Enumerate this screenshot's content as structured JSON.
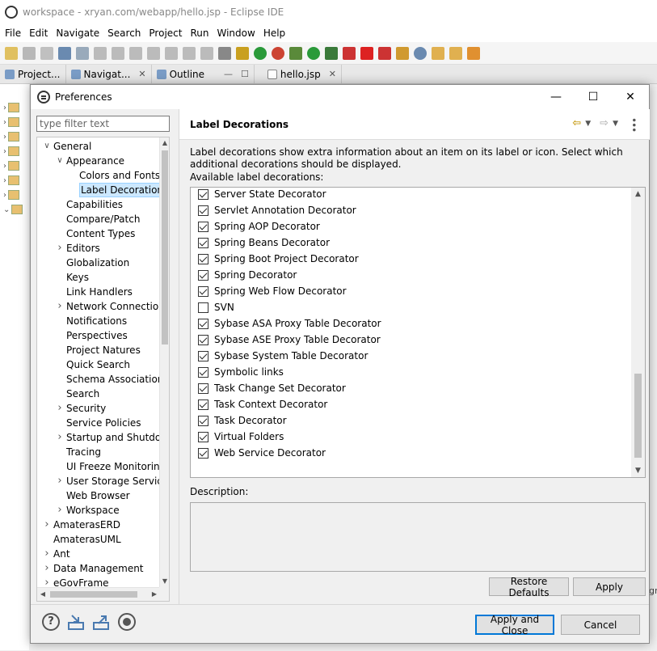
{
  "ide": {
    "title": "workspace - xryan.com/webapp/hello.jsp - Eclipse IDE",
    "menu": [
      "File",
      "Edit",
      "Navigate",
      "Search",
      "Project",
      "Run",
      "Window",
      "Help"
    ],
    "tabs": [
      {
        "label": "Project..."
      },
      {
        "label": "Navigat..."
      },
      {
        "label": "Outline"
      },
      {
        "label": "hello.jsp"
      }
    ],
    "right_fragment": "gr"
  },
  "dialog": {
    "title": "Preferences",
    "filter_placeholder": "type filter text",
    "tree": [
      {
        "label": "General",
        "level": 0,
        "twisty": "open"
      },
      {
        "label": "Appearance",
        "level": 1,
        "twisty": "open"
      },
      {
        "label": "Colors and Fonts",
        "level": 2,
        "twisty": "none"
      },
      {
        "label": "Label Decorations",
        "level": 2,
        "twisty": "none",
        "selected": true
      },
      {
        "label": "Capabilities",
        "level": 1,
        "twisty": "none"
      },
      {
        "label": "Compare/Patch",
        "level": 1,
        "twisty": "none"
      },
      {
        "label": "Content Types",
        "level": 1,
        "twisty": "none"
      },
      {
        "label": "Editors",
        "level": 1,
        "twisty": "closed"
      },
      {
        "label": "Globalization",
        "level": 1,
        "twisty": "none"
      },
      {
        "label": "Keys",
        "level": 1,
        "twisty": "none"
      },
      {
        "label": "Link Handlers",
        "level": 1,
        "twisty": "none"
      },
      {
        "label": "Network Connections",
        "level": 1,
        "twisty": "closed"
      },
      {
        "label": "Notifications",
        "level": 1,
        "twisty": "none"
      },
      {
        "label": "Perspectives",
        "level": 1,
        "twisty": "none"
      },
      {
        "label": "Project Natures",
        "level": 1,
        "twisty": "none"
      },
      {
        "label": "Quick Search",
        "level": 1,
        "twisty": "none"
      },
      {
        "label": "Schema Associations",
        "level": 1,
        "twisty": "none"
      },
      {
        "label": "Search",
        "level": 1,
        "twisty": "none"
      },
      {
        "label": "Security",
        "level": 1,
        "twisty": "closed"
      },
      {
        "label": "Service Policies",
        "level": 1,
        "twisty": "none"
      },
      {
        "label": "Startup and Shutdown",
        "level": 1,
        "twisty": "closed"
      },
      {
        "label": "Tracing",
        "level": 1,
        "twisty": "none"
      },
      {
        "label": "UI Freeze Monitoring",
        "level": 1,
        "twisty": "none"
      },
      {
        "label": "User Storage Service",
        "level": 1,
        "twisty": "closed"
      },
      {
        "label": "Web Browser",
        "level": 1,
        "twisty": "none"
      },
      {
        "label": "Workspace",
        "level": 1,
        "twisty": "closed"
      },
      {
        "label": "AmaterasERD",
        "level": 0,
        "twisty": "closed"
      },
      {
        "label": "AmaterasUML",
        "level": 0,
        "twisty": "none"
      },
      {
        "label": "Ant",
        "level": 0,
        "twisty": "closed"
      },
      {
        "label": "Data Management",
        "level": 0,
        "twisty": "closed"
      },
      {
        "label": "eGovFrame",
        "level": 0,
        "twisty": "closed"
      }
    ],
    "page": {
      "title": "Label Decorations",
      "description": "Label decorations show extra information about an item on its label or icon. Select which additional decorations should be displayed.",
      "available_label": "Available label decorations:",
      "decorations": [
        {
          "label": "Server State Decorator",
          "checked": true
        },
        {
          "label": "Servlet Annotation Decorator",
          "checked": true
        },
        {
          "label": "Spring AOP Decorator",
          "checked": true
        },
        {
          "label": "Spring Beans Decorator",
          "checked": true
        },
        {
          "label": "Spring Boot Project Decorator",
          "checked": true
        },
        {
          "label": "Spring Decorator",
          "checked": true
        },
        {
          "label": "Spring Web Flow Decorator",
          "checked": true
        },
        {
          "label": "SVN",
          "checked": false
        },
        {
          "label": "Sybase ASA Proxy Table Decorator",
          "checked": true
        },
        {
          "label": "Sybase ASE Proxy Table Decorator",
          "checked": true
        },
        {
          "label": "Sybase System Table Decorator",
          "checked": true
        },
        {
          "label": "Symbolic links",
          "checked": true
        },
        {
          "label": "Task Change Set Decorator",
          "checked": true
        },
        {
          "label": "Task Context Decorator",
          "checked": true
        },
        {
          "label": "Task Decorator",
          "checked": true
        },
        {
          "label": "Virtual Folders",
          "checked": true
        },
        {
          "label": "Web Service Decorator",
          "checked": true
        }
      ],
      "description_label": "Description:",
      "restore_defaults_label": "Restore Defaults",
      "apply_label": "Apply"
    },
    "apply_close_label": "Apply and Close",
    "cancel_label": "Cancel"
  },
  "colors": {
    "selection_bg": "#cce8ff",
    "default_button_border": "#0078d7",
    "nav_back": "#c9a020"
  }
}
